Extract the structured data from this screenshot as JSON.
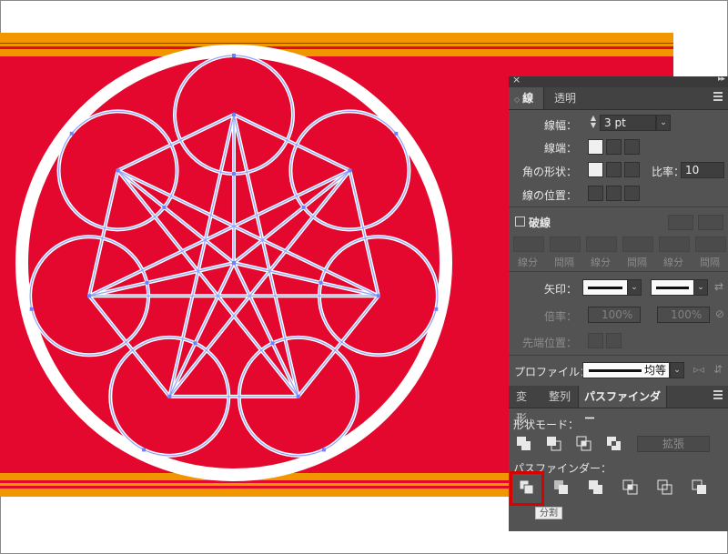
{
  "artwork": {
    "colors": {
      "background_red": "#e4082f",
      "stripe_orange": "#f29600",
      "ring_white": "#ffffff",
      "path_blue": "#8fa2ff"
    }
  },
  "panel": {
    "stroke_tabs": [
      "線",
      "透明"
    ],
    "stroke": {
      "weight_label": "線幅：",
      "weight_value": "3 pt",
      "cap_label": "線端：",
      "corner_label": "角の形状：",
      "limit_label": "比率：",
      "limit_value": "10",
      "align_label": "線の位置：",
      "dashed_label": "破線",
      "dash_labels": [
        "線分",
        "間隔",
        "線分",
        "間隔",
        "線分",
        "間隔"
      ],
      "arrow_label": "矢印：",
      "scale_label": "倍率：",
      "scale_values": [
        "100%",
        "100%"
      ],
      "tip_label": "先端位置：",
      "profile_label": "プロファイル：",
      "profile_value": "均等"
    },
    "lower_tabs": [
      "変形",
      "整列",
      "パスファインダー"
    ],
    "pathfinder": {
      "shape_modes_label": "形状モード：",
      "expand_label": "拡張",
      "pathfinders_label": "パスファインダー：",
      "tooltip": "分割"
    }
  }
}
